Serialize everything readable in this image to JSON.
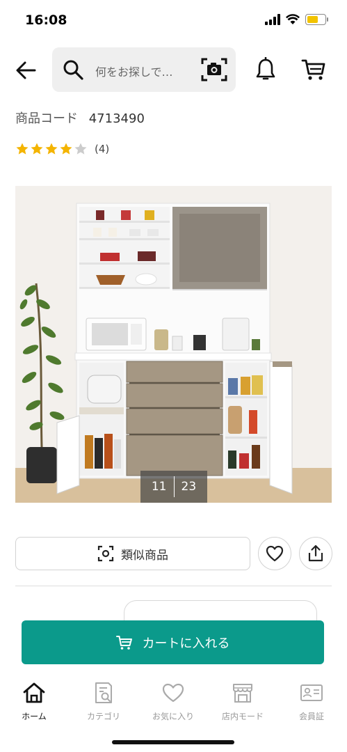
{
  "status_bar": {
    "time": "16:08",
    "battery_color": "#f2c300"
  },
  "header": {
    "search_placeholder": "何をお探しで…",
    "icons": [
      "back-arrow-icon",
      "search-icon",
      "camera-scan-icon",
      "bell-icon",
      "cart-icon"
    ]
  },
  "product": {
    "code_label": "商品コード",
    "code_value": "4713490",
    "rating": 4,
    "rating_max": 5,
    "review_count": "(4)",
    "image_index": "11",
    "image_total": "23"
  },
  "actions": {
    "similar_label": "類似商品",
    "add_to_cart_label": "カートに入れる"
  },
  "bottom_nav": {
    "items": [
      {
        "label": "ホーム",
        "icon": "home-icon",
        "active": true
      },
      {
        "label": "カテゴリ",
        "icon": "category-icon",
        "active": false
      },
      {
        "label": "お気に入り",
        "icon": "heart-icon",
        "active": false
      },
      {
        "label": "店内モード",
        "icon": "store-icon",
        "active": false
      },
      {
        "label": "会員証",
        "icon": "member-card-icon",
        "active": false
      }
    ]
  },
  "colors": {
    "accent": "#0b9a8b",
    "star": "#f4b400",
    "star_empty": "#cccccc"
  }
}
